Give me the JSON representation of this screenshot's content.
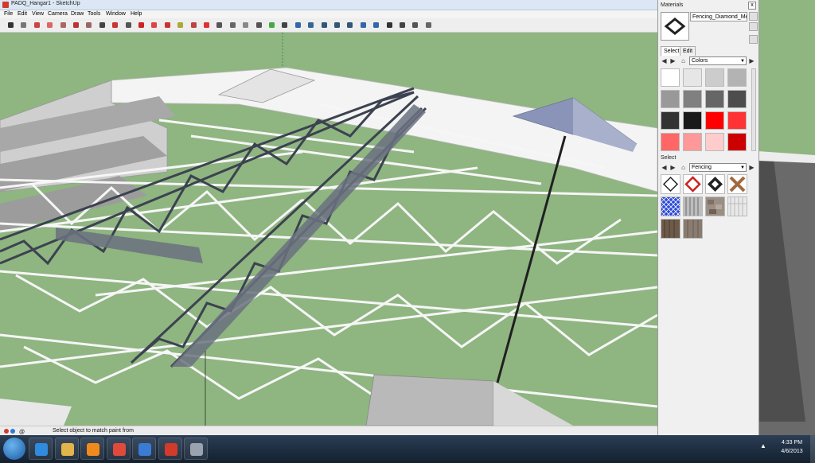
{
  "window": {
    "title": "PADQ_Hangar1 - SketchUp"
  },
  "menu": [
    "File",
    "Edit",
    "View",
    "Camera",
    "Draw",
    "Tools",
    "Window",
    "Help"
  ],
  "toolbar": {
    "tools": [
      "select-tool",
      "component-tool",
      "paint-bucket-tool",
      "eraser-tool",
      "rectangle-tool",
      "line-tool",
      "circle-tool",
      "arc-tool",
      "polygon-tool",
      "freehand-tool",
      "move-tool",
      "push-pull-tool",
      "rotate-tool",
      "follow-me-tool",
      "scale-tool",
      "offset-tool",
      "tape-measure-tool",
      "dimension-tool",
      "protractor-tool",
      "text-tool",
      "axes-tool",
      "3d-text-tool",
      "orbit-tool",
      "pan-tool",
      "zoom-tool",
      "zoom-window-tool",
      "zoom-extents-tool",
      "previous-tool",
      "next-tool",
      "position-camera-tool",
      "walk-tool",
      "look-around-tool",
      "section-plane-tool"
    ]
  },
  "status": {
    "text": "Select object to match paint from"
  },
  "materials": {
    "title": "Materials",
    "close": "x",
    "material_name": "Fencing_Diamond_Mesh",
    "tabs": [
      "Select",
      "Edit"
    ],
    "colors_dropdown": "Colors",
    "select_label": "Select",
    "fencing_dropdown": "Fencing",
    "colors": [
      "#ffffff",
      "#e6e6e6",
      "#cccccc",
      "#b3b3b3",
      "#999999",
      "#808080",
      "#666666",
      "#4d4d4d",
      "#333333",
      "#1a1a1a",
      "#ff0000",
      "#ff3333",
      "#ff6666",
      "#ff9999",
      "#ffcccc",
      "#cc0000"
    ],
    "fencing": [
      "diamond-white",
      "diamond-red",
      "diamond-black",
      "x-brace-wood",
      "diamond-blue-mesh",
      "picket-gray",
      "stone-fence",
      "picket-white",
      "wood-dark",
      "wood-board"
    ]
  },
  "taskbar": {
    "apps": [
      "ie-icon",
      "folder-icon",
      "media-player-icon",
      "chrome-icon",
      "network-icon",
      "sketchup-icon",
      "sketchup-viewer-icon"
    ],
    "time": "4:33 PM",
    "date": "4/6/2013"
  }
}
